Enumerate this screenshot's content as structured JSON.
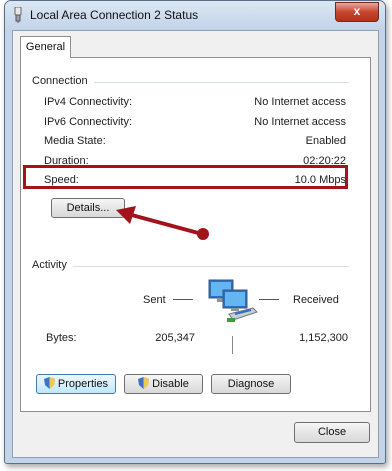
{
  "window": {
    "title": "Local Area Connection 2 Status",
    "close_label": "x"
  },
  "tabs": [
    {
      "label": "General"
    }
  ],
  "connection": {
    "group_label": "Connection",
    "rows": [
      {
        "label": "IPv4 Connectivity:",
        "value": "No Internet access"
      },
      {
        "label": "IPv6 Connectivity:",
        "value": "No Internet access"
      },
      {
        "label": "Media State:",
        "value": "Enabled"
      },
      {
        "label": "Duration:",
        "value": "02:20:22"
      },
      {
        "label": "Speed:",
        "value": "10.0 Mbps"
      }
    ],
    "details_button": "Details..."
  },
  "activity": {
    "group_label": "Activity",
    "sent_label": "Sent",
    "received_label": "Received",
    "bytes_label": "Bytes:",
    "bytes_sent": "205,347",
    "bytes_received": "1,152,300"
  },
  "buttons": {
    "properties": "Properties",
    "disable": "Disable",
    "diagnose": "Diagnose",
    "close": "Close"
  },
  "colors": {
    "annotation_red": "#a3131b",
    "frame_blue": "#c3d4e8"
  },
  "icons": {
    "title": "network-connection-icon",
    "activity": "network-computers-icon",
    "shield": "uac-shield-icon"
  }
}
